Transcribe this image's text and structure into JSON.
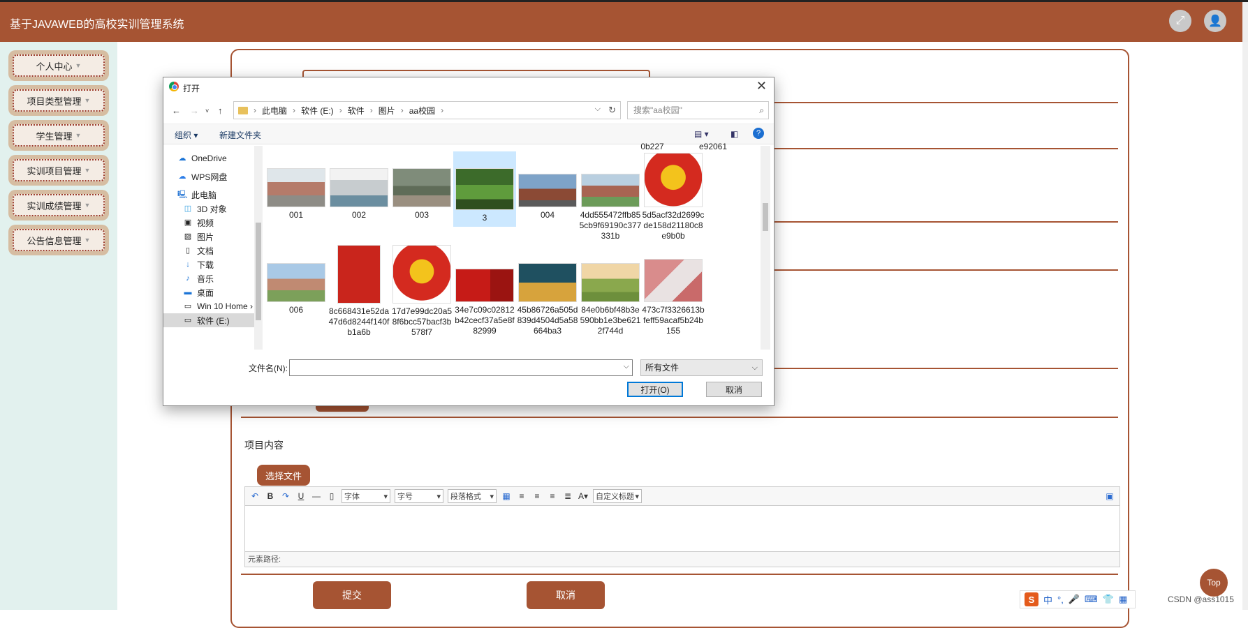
{
  "app": {
    "title": "基于JAVAWEB的高校实训管理系统"
  },
  "header": {
    "fullscreen_icon": "expand-icon",
    "user_icon": "user-icon"
  },
  "sidebar": {
    "items": [
      {
        "label": "个人中心"
      },
      {
        "label": "项目类型管理"
      },
      {
        "label": "学生管理"
      },
      {
        "label": "实训项目管理"
      },
      {
        "label": "实训成绩管理"
      },
      {
        "label": "公告信息管理"
      }
    ]
  },
  "form": {
    "content_label": "项目内容",
    "choose_file": "选择文件",
    "submit": "提交",
    "cancel": "取消"
  },
  "editor": {
    "font_select": "字体",
    "size_select": "字号",
    "paragraph_select": "段落格式",
    "custom_title_select": "自定义标题",
    "path_label": "元素路径:"
  },
  "dialog": {
    "title": "打开",
    "breadcrumb": [
      "此电脑",
      "软件 (E:)",
      "软件",
      "图片",
      "aa校园"
    ],
    "search_placeholder": "搜索\"aa校园\"",
    "organize": "组织 ▾",
    "new_folder": "新建文件夹",
    "nav_items": [
      "OneDrive",
      "WPS网盘",
      "此电脑",
      "3D 对象",
      "视频",
      "图片",
      "文档",
      "下载",
      "音乐",
      "桌面",
      "Win 10 Home ›",
      "软件 (E:)"
    ],
    "files_top_partial": [
      "0b227",
      "e92061"
    ],
    "files_row1": [
      "001",
      "002",
      "003",
      "3",
      "004",
      "4dd555472ffb855cb9f69190c377331b",
      "5d5acf32d2699cde158d21180c8e9b0b"
    ],
    "files_row2": [
      "006",
      "8c668431e52da47d6d8244f140fb1a6b",
      "17d7e99dc20a58f6bcc57bacf3b578f7",
      "34e7c09c02812b42cecf37a5e8f82999",
      "45b86726a505d839d4504d5a58664ba3",
      "84e0b6bf48b3e590bb1e3be6212f744d",
      "473c7f3326613bfeff59acaf5b24b155"
    ],
    "filename_label": "文件名(N):",
    "filename_value": "",
    "filter_value": "所有文件",
    "open_button": "打开(O)",
    "cancel_button": "取消"
  },
  "top_button": "Top",
  "ime": {
    "mode": "中",
    "logo": "S"
  },
  "watermark": "CSDN @ass1015",
  "colors": {
    "brand": "#a65433",
    "sidebar_bg": "#e2f1ee",
    "selection": "#cce8ff"
  }
}
